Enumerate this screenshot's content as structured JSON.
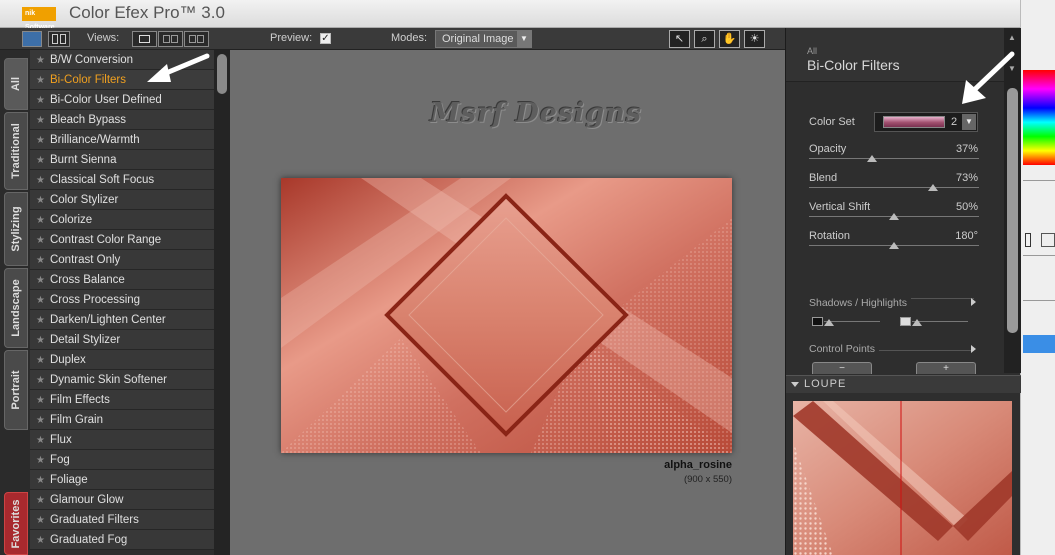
{
  "window": {
    "title": "Color Efex Pro™ 3.0",
    "logo_text": "nik Software"
  },
  "toolbar": {
    "views_label": "Views:",
    "preview_label": "Preview:",
    "preview_checked": "✓",
    "modes_label": "Modes:",
    "modes_value": "Original Image",
    "tools": [
      "arrow-tool",
      "zoom-tool",
      "hand-tool",
      "sun-tool"
    ]
  },
  "side_tabs": [
    "All",
    "Traditional",
    "Stylizing",
    "Landscape",
    "Portrait",
    "Favorites"
  ],
  "filters": [
    "B/W Conversion",
    "Bi-Color Filters",
    "Bi-Color User Defined",
    "Bleach Bypass",
    "Brilliance/Warmth",
    "Burnt Sienna",
    "Classical Soft Focus",
    "Color Stylizer",
    "Colorize",
    "Contrast Color Range",
    "Contrast Only",
    "Cross Balance",
    "Cross Processing",
    "Darken/Lighten Center",
    "Detail Stylizer",
    "Duplex",
    "Dynamic Skin Softener",
    "Film Effects",
    "Film Grain",
    "Flux",
    "Fog",
    "Foliage",
    "Glamour Glow",
    "Graduated Filters",
    "Graduated Fog"
  ],
  "active_filter_index": 1,
  "canvas": {
    "watermark": "Msrf Designs",
    "image_name": "alpha_rosine",
    "image_size": "(900 x 550)"
  },
  "panel": {
    "category": "All",
    "title": "Bi-Color Filters",
    "color_set_label": "Color Set",
    "color_set_value": "2",
    "params": [
      {
        "label": "Opacity",
        "value": "37%",
        "level": 0.37
      },
      {
        "label": "Blend",
        "value": "73%",
        "level": 0.73
      },
      {
        "label": "Vertical Shift",
        "value": "50%",
        "level": 0.5
      },
      {
        "label": "Rotation",
        "value": "180°",
        "level": 0.5
      }
    ],
    "shadows_label": "Shadows / Highlights",
    "control_points_label": "Control Points",
    "cp_minus": "−",
    "cp_plus": "+",
    "loupe_label": "LOUPE"
  },
  "colors": {
    "accent": "#f0a020",
    "photo_base": "#c8604e",
    "photo_frame": "#8a2416"
  }
}
